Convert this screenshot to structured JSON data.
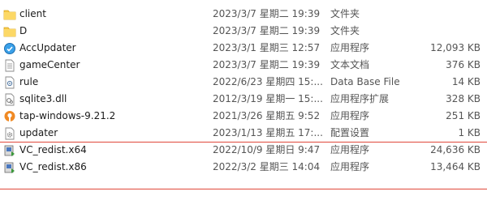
{
  "files": [
    {
      "name": "client",
      "date": "2023/3/7 星期二 19:39",
      "type": "文件夹",
      "size": "",
      "icon": "folder-icon"
    },
    {
      "name": "D",
      "date": "2023/3/7 星期二 19:39",
      "type": "文件夹",
      "size": "",
      "icon": "folder-icon"
    },
    {
      "name": "AccUpdater",
      "date": "2023/3/1 星期三 12:57",
      "type": "应用程序",
      "size": "12,093 KB",
      "icon": "app-icon"
    },
    {
      "name": "gameCenter",
      "date": "2023/3/7 星期二 19:39",
      "type": "文本文档",
      "size": "376 KB",
      "icon": "text-file-icon"
    },
    {
      "name": "rule",
      "date": "2022/6/23 星期四 15:...",
      "type": "Data Base File",
      "size": "14 KB",
      "icon": "database-file-icon"
    },
    {
      "name": "sqlite3.dll",
      "date": "2012/3/19 星期一 15:...",
      "type": "应用程序扩展",
      "size": "328 KB",
      "icon": "dll-file-icon"
    },
    {
      "name": "tap-windows-9.21.2",
      "date": "2021/3/26 星期五 9:52",
      "type": "应用程序",
      "size": "251 KB",
      "icon": "tap-installer-icon"
    },
    {
      "name": "updater",
      "date": "2023/1/13 星期五 17:...",
      "type": "配置设置",
      "size": "1 KB",
      "icon": "config-file-icon"
    },
    {
      "name": "VC_redist.x64",
      "date": "2022/10/9 星期日 9:47",
      "type": "应用程序",
      "size": "24,636 KB",
      "icon": "installer-icon"
    },
    {
      "name": "VC_redist.x86",
      "date": "2022/3/2 星期三 14:04",
      "type": "应用程序",
      "size": "13,464 KB",
      "icon": "installer-icon"
    }
  ],
  "colors": {
    "folder": "#f7c948",
    "separator": "#e0483a",
    "text_secondary": "#555555"
  }
}
